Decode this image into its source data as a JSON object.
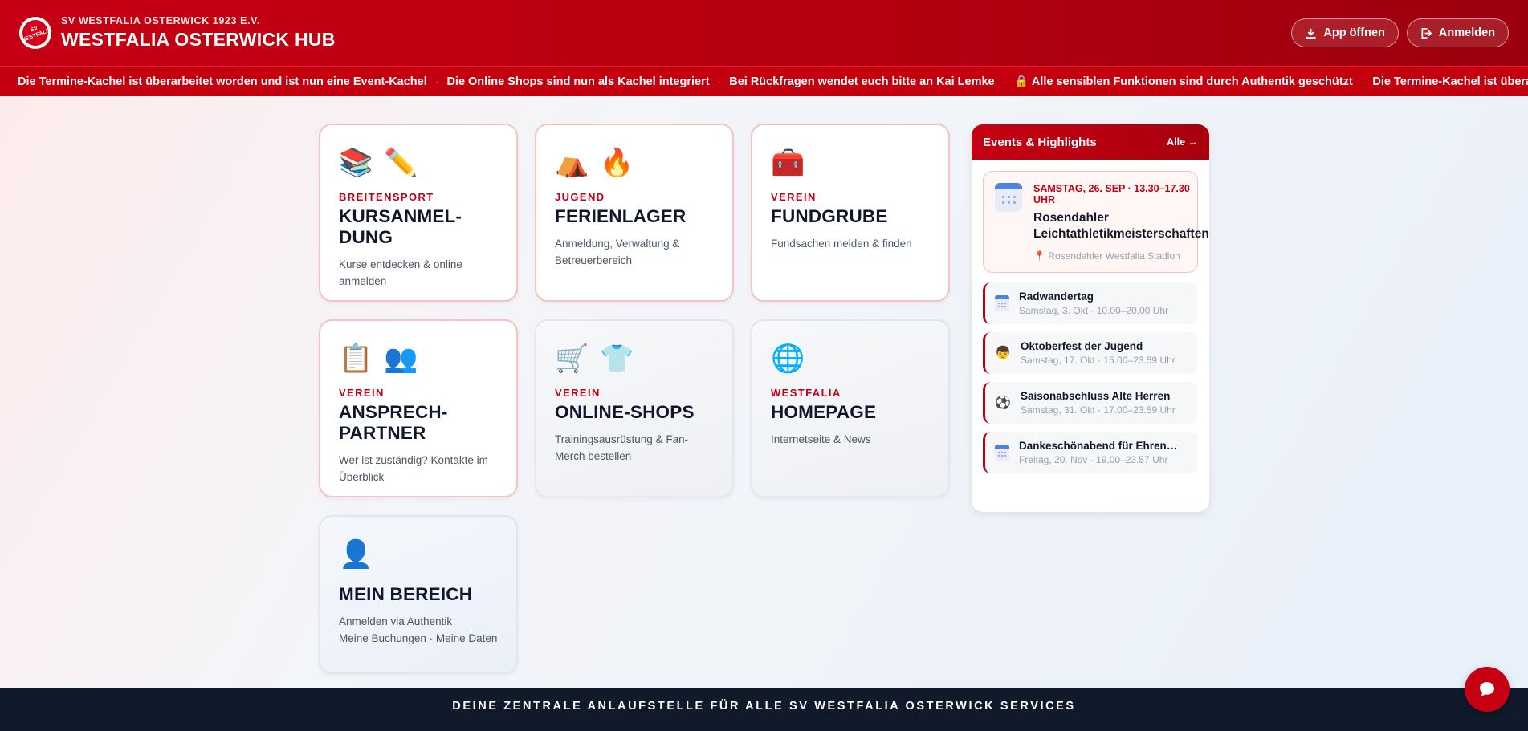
{
  "header": {
    "club_name": "SV WESTFALIA OSTERWICK 1923 E.V.",
    "hub_title": "WESTFALIA OSTERWICK HUB",
    "crest_text": "SV WESTFALIA",
    "app_button": "App öffnen",
    "login_button": "Anmelden"
  },
  "ticker": {
    "items": [
      "Die Termine-Kachel ist überarbeitet worden und ist nun eine Event-Kachel",
      "Die Online Shops sind nun als Kachel integriert",
      "Bei Rückfragen wendet euch bitte an Kai Lemke",
      "🔒 Alle sensiblen Funktionen sind durch Authentik geschützt",
      "Die Termine-Kachel ist überarbeitet worden und ist nun eine Event-Kachel"
    ],
    "separator": "·"
  },
  "tiles": [
    {
      "icons": [
        "📚",
        "✏️"
      ],
      "kicker": "BREITENSPORT",
      "title": "KURSANMEL-\nDUNG",
      "desc": "Kurse entdecken & online anmelden"
    },
    {
      "icons": [
        "⛺",
        "🔥"
      ],
      "kicker": "JUGEND",
      "title": "FERIENLAGER",
      "desc": "Anmeldung, Verwaltung & Betreuerbereich"
    },
    {
      "icons": [
        "🧰"
      ],
      "kicker": "VEREIN",
      "title": "FUNDGRUBE",
      "desc": "Fundsachen melden & finden"
    },
    {
      "icons": [
        "📋",
        "👥"
      ],
      "kicker": "VEREIN",
      "title": "ANSPRECH-\nPARTNER",
      "desc": "Wer ist zuständig? Kontakte im Überblick"
    },
    {
      "icons": [
        "🛒",
        "👕"
      ],
      "kicker": "VEREIN",
      "title": "ONLINE-SHOPS",
      "desc": "Trainingsausrüstung & Fan-Merch bestellen"
    },
    {
      "icons": [
        "🌐"
      ],
      "kicker": "WESTFALIA",
      "title": "HOMEPAGE",
      "desc": "Internetseite & News"
    },
    {
      "icons": [
        "👤"
      ],
      "kicker": "",
      "title": "MEIN BEREICH",
      "desc": "Anmelden via Authentik\nMeine Buchungen · Meine Daten"
    }
  ],
  "events": {
    "title": "Events & Highlights",
    "all_link": "Alle →",
    "featured": {
      "date": "SAMSTAG, 26. SEP · 13.30–17.30 UHR",
      "title": "Rosendahler Leichtathletikmeisterschaften",
      "location": "📍 Rosendahler Westfalia Stadion",
      "icon": "calendar-icon"
    },
    "list": [
      {
        "icon": "calendar-icon",
        "glyph": "",
        "title": "Radwandertag",
        "sub": "Samstag, 3. Okt · 10.00–20.00 Uhr"
      },
      {
        "icon": "child-face-icon",
        "glyph": "👦",
        "title": "Oktoberfest der Jugend",
        "sub": "Samstag, 17. Okt · 15.00–23.59 Uhr"
      },
      {
        "icon": "soccer-ball-icon",
        "glyph": "⚽",
        "title": "Saisonabschluss Alte Herren",
        "sub": "Samstag, 31. Okt · 17.00–23.59 Uhr"
      },
      {
        "icon": "calendar-icon",
        "glyph": "",
        "title": "Dankeschönabend für Ehrena...",
        "sub": "Freitag, 20. Nov · 19.00–23.57 Uhr"
      }
    ]
  },
  "footer": {
    "text": "DEINE ZENTRALE ANLAUFSTELLE FÜR ALLE SV WESTFALIA OSTERWICK SERVICES"
  },
  "colors": {
    "primary_red": "#c60012",
    "footer_navy": "#111a2b",
    "kicker_red": "#c00012"
  }
}
